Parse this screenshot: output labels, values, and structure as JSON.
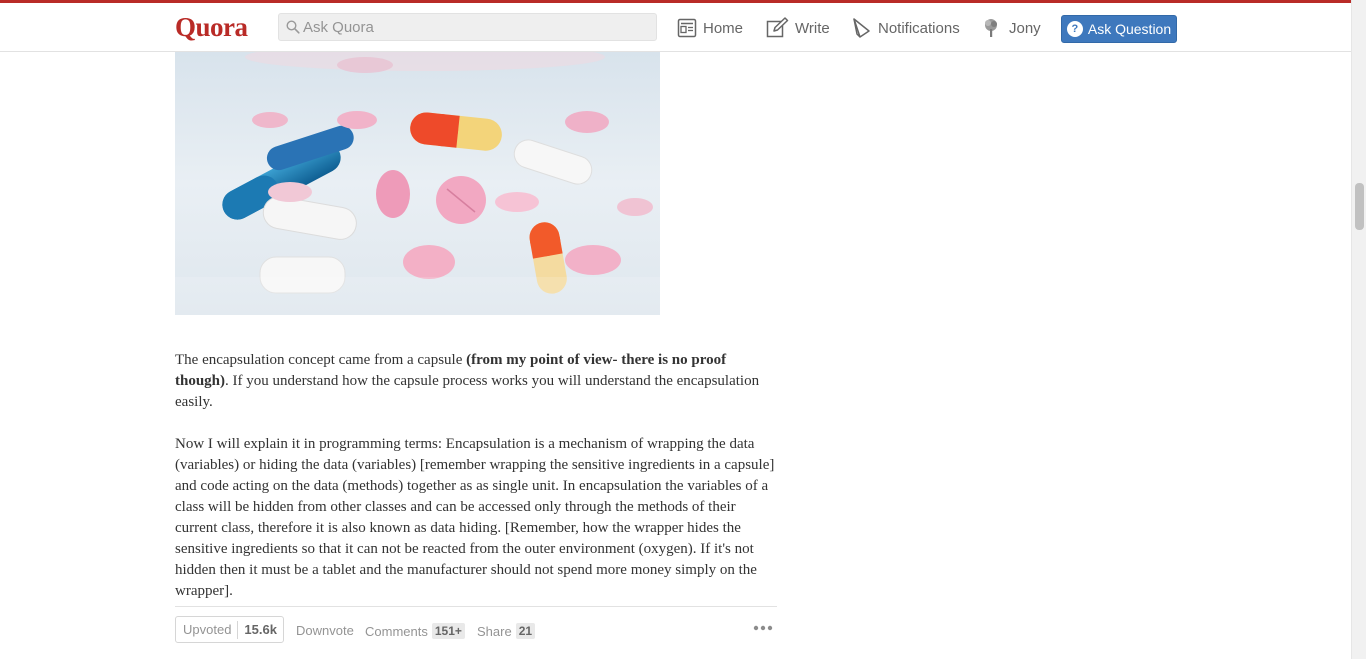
{
  "header": {
    "logo": "Quora",
    "search_placeholder": "Ask Quora",
    "nav": {
      "home": "Home",
      "write": "Write",
      "notifications": "Notifications",
      "profile": "Jony"
    },
    "ask_button": "Ask Question"
  },
  "answer": {
    "para1_start": "The encapsulation concept came from a capsule ",
    "para1_bold": "(from my point of view- there is no proof though)",
    "para1_end": ". If you understand how the capsule process works you will understand the encapsulation easily.",
    "para2": "Now I will explain it in programming terms: Encapsulation is a mechanism of wrapping the data (variables) or hiding the data (variables) [remember wrapping the sensitive ingredients in a capsule] and code acting on the data (methods) together as as single unit. In encapsulation the variables of a class will be hidden from other classes and can be accessed only through the methods of their current class, therefore it is also known as data hiding. [Remember, how the wrapper hides the sensitive ingredients so that it can not be reacted from the outer environment (oxygen). If it's not hidden then it must be a tablet and the manufacturer should not spend more money simply on the wrapper]."
  },
  "actions": {
    "upvoted_label": "Upvoted",
    "upvote_count": "15.6k",
    "downvote_label": "Downvote",
    "comments_label": "Comments",
    "comments_count": "151+",
    "share_label": "Share",
    "share_count": "21"
  },
  "colors": {
    "brand": "#b92b27",
    "ask_button": "#3e78bd"
  }
}
